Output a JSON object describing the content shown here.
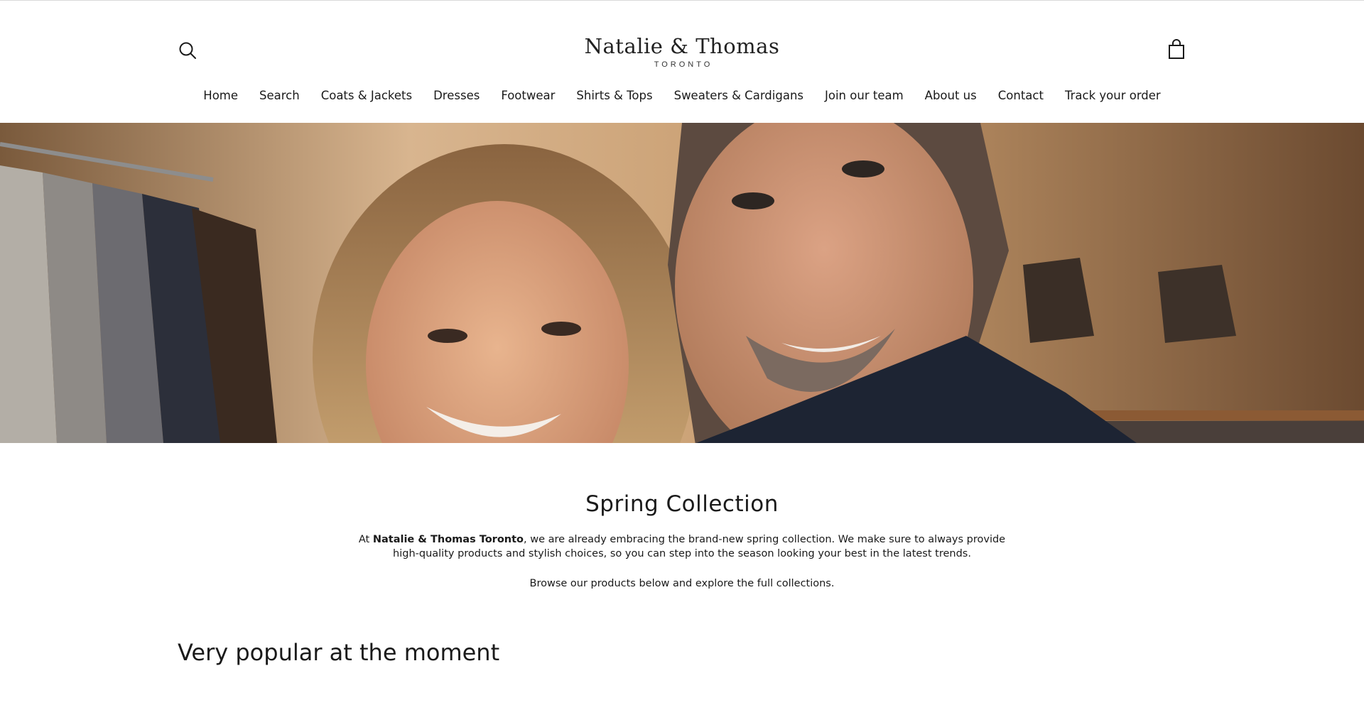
{
  "header": {
    "logo_name": "Natalie & Thomas",
    "logo_city": "TORONTO",
    "search_icon": "search-icon",
    "cart_icon": "shopping-bag-icon"
  },
  "nav": {
    "items": [
      "Home",
      "Search",
      "Coats & Jackets",
      "Dresses",
      "Footwear",
      "Shirts & Tops",
      "Sweaters & Cardigans",
      "Join our team",
      "About us",
      "Contact",
      "Track your order"
    ]
  },
  "intro": {
    "title": "Spring Collection",
    "p1_before": "At ",
    "p1_bold": "Natalie & Thomas Toronto",
    "p1_after": ", we are already embracing the brand-new spring collection. We make sure to always provide high-quality products and stylish choices, so you can step into the season looking your best in the latest trends.",
    "p2": "Browse our products below and explore the full collections."
  },
  "popular": {
    "title": "Very popular at the moment"
  },
  "colors": {
    "text": "#1a1a1a",
    "background": "#ffffff",
    "hero_warm": "#b98e62"
  }
}
